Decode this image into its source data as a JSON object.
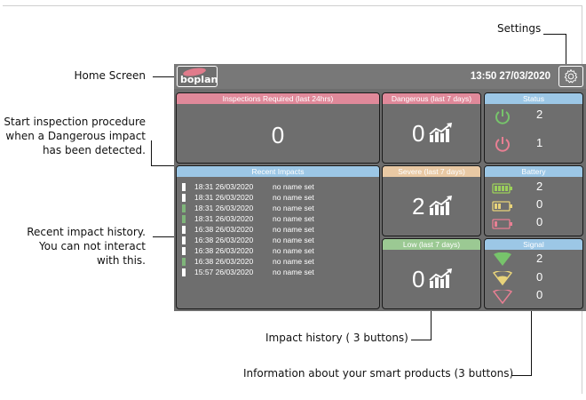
{
  "callouts": {
    "settings": "Settings",
    "home": "Home Screen",
    "start": [
      "Start inspection procedure",
      "when a Dangerous impact",
      "has been detected."
    ],
    "recent": [
      "Recent impact history.",
      "You can not interact",
      "with this."
    ],
    "impact": "Impact history ( 3 buttons)",
    "info": "Information about your smart products (3 buttons)"
  },
  "topbar": {
    "logo": "boplan",
    "datetime": "13:50 27/03/2020",
    "settings_icon": "gear-icon"
  },
  "inspections": {
    "title": "Inspections Required (last 24hrs)",
    "count": "0"
  },
  "recent": {
    "title": "Recent Impacts",
    "rows": [
      {
        "time": "18:31 26/03/2020",
        "name": "no name set",
        "marker": "white"
      },
      {
        "time": "18:31 26/03/2020",
        "name": "no name set",
        "marker": "white"
      },
      {
        "time": "18:31 26/03/2020",
        "name": "no name set",
        "marker": "green"
      },
      {
        "time": "18:31 26/03/2020",
        "name": "no name set",
        "marker": "green"
      },
      {
        "time": "16:38 26/03/2020",
        "name": "no name set",
        "marker": "white"
      },
      {
        "time": "16:38 26/03/2020",
        "name": "no name set",
        "marker": "white"
      },
      {
        "time": "16:38 26/03/2020",
        "name": "no name set",
        "marker": "white"
      },
      {
        "time": "16:38 26/03/2020",
        "name": "no name set",
        "marker": "green"
      },
      {
        "time": "15:57 26/03/2020",
        "name": "no name set",
        "marker": "white"
      }
    ]
  },
  "impacts": {
    "dangerous": {
      "title": "Dangerous (last 7 days)",
      "count": "0"
    },
    "severe": {
      "title": "Severe (last 7 days)",
      "count": "2"
    },
    "low": {
      "title": "Low (last 7 days)",
      "count": "0"
    },
    "icon": "trend-chart-icon"
  },
  "status": {
    "title": "Status",
    "online": "2",
    "offline": "1"
  },
  "battery": {
    "title": "Battery",
    "full": "2",
    "medium": "0",
    "low": "0"
  },
  "signal": {
    "title": "Signal",
    "strong": "2",
    "medium": "0",
    "weak": "0"
  },
  "colors": {
    "accent_pink": "#e0899a",
    "accent_blue": "#9cc7e6",
    "accent_peach": "#e9c9a4",
    "accent_green": "#9bc993",
    "screen": "#6d6d6d"
  }
}
